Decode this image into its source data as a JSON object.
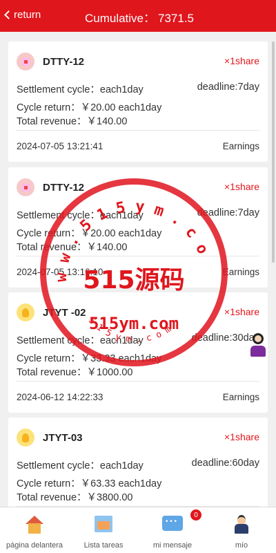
{
  "header": {
    "back_label": "return",
    "title_label": "Cumulative：",
    "title_value": "7371.5",
    "color": "#e0161d"
  },
  "cards": [
    {
      "name": "DTTY-12",
      "icon": "gift-icon",
      "share": "×1share",
      "settlement": "Settlement cycle：each1day",
      "deadline": "deadline:7day",
      "cycle_return": "Cycle return：￥20.00 each1day",
      "total_revenue": "Total revenue：￥140.00",
      "date": "2024-07-05 13:21:41",
      "earnings": "Earnings"
    },
    {
      "name": "DTTY-12",
      "icon": "gift-icon",
      "share": "×1share",
      "settlement": "Settlement cycle：each1day",
      "deadline": "deadline:7day",
      "cycle_return": "Cycle return：￥20.00 each1day",
      "total_revenue": "Total revenue：￥140.00",
      "date": "2024-07-05 13:16:10",
      "earnings": "Earnings"
    },
    {
      "name": "JTYT -02",
      "icon": "bulb-icon",
      "share": "×1share",
      "settlement": "Settlement cycle：each1day",
      "deadline": "deadline:30day",
      "cycle_return": "Cycle return：￥33.33 each1day",
      "total_revenue": "Total revenue：￥1000.00",
      "date": "2024-06-12 14:22:33",
      "earnings": "Earnings"
    },
    {
      "name": "JTYT-03",
      "icon": "bulb-icon",
      "share": "×1share",
      "settlement": "Settlement cycle：each1day",
      "deadline": "deadline:60day",
      "cycle_return": "Cycle return：￥63.33 each1day",
      "total_revenue": "Total revenue：￥3800.00"
    }
  ],
  "watermark": {
    "main": "515源码",
    "domain": "515ym.com",
    "arc_top": "w w . 5 1 5 y m . c o m",
    "arc_bottom": "5 1 5 y m . c o m"
  },
  "tabbar": {
    "tabs": [
      {
        "label": "página delantera",
        "icon": "home-icon"
      },
      {
        "label": "Lista tareas",
        "icon": "task-list-icon"
      },
      {
        "label": "mi mensaje",
        "icon": "message-icon"
      },
      {
        "label": "mío",
        "icon": "profile-icon"
      }
    ],
    "message_badge": "0"
  }
}
